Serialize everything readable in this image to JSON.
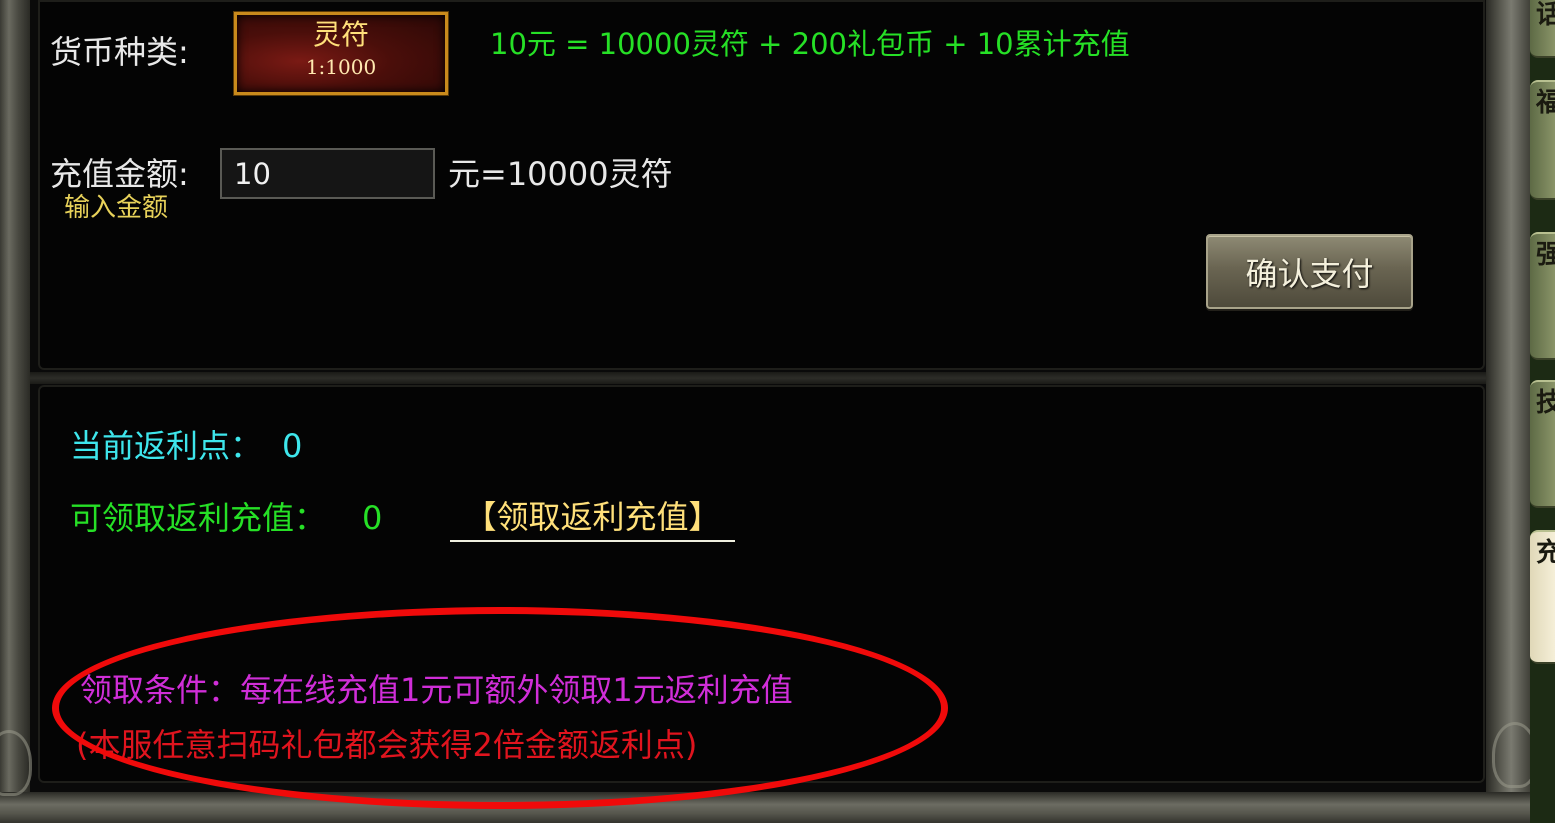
{
  "recharge": {
    "currency_type_label": "货币种类:",
    "currency": {
      "name": "灵符",
      "ratio": "1:1000"
    },
    "rate_text": "10元 = 10000灵符 + 200礼包币 + 10累计充值",
    "amount_label": "充值金额:",
    "amount_value": "10",
    "amount_hint": "输入金额",
    "amount_equals": "元=10000灵符",
    "pay_button": "确认支付"
  },
  "rebate": {
    "current_points_label": "当前返利点：",
    "current_points_value": "0",
    "claimable_label": "可领取返利充值：",
    "claimable_value": "0",
    "claim_link": "【领取返利充值】",
    "condition_text": "领取条件：每在线充值1元可额外领取1元返利充值",
    "note_text": "(本服任意扫码礼包都会获得2倍金额返利点)"
  },
  "side_tabs": [
    "话",
    "福利",
    "强化",
    "技能",
    "充值"
  ],
  "colors": {
    "rate_green": "#26e026",
    "cyan": "#3ee6ec",
    "gold": "#ffe07a",
    "magenta": "#d02ed8",
    "red": "#e0141e",
    "annotation_red": "#f00a0a"
  }
}
